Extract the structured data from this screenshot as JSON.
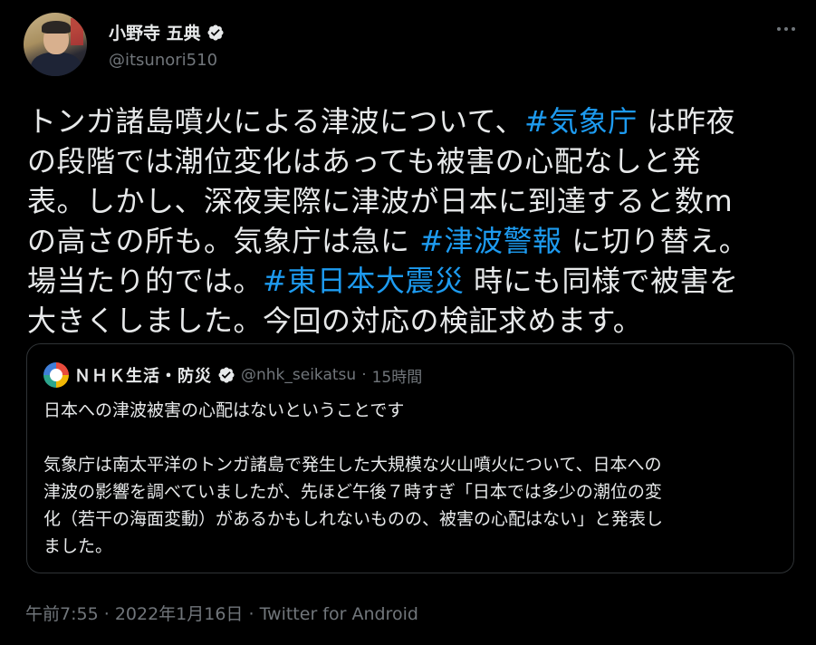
{
  "author": {
    "name": "小野寺 五典",
    "handle": "@itsunori510"
  },
  "tweet": {
    "lines": [
      {
        "before": "トンガ諸島噴火による津波について、",
        "tag": "#気象庁",
        "after": " は昨夜"
      },
      {
        "before": "の段階では潮位変化はあっても被害の心配なしと発",
        "tag": "",
        "after": ""
      },
      {
        "before": "表。しかし、深夜実際に津波が日本に到達すると数m",
        "tag": "",
        "after": ""
      },
      {
        "before": "の高さの所も。気象庁は急に ",
        "tag": "#津波警報",
        "after": " に切り替え。"
      },
      {
        "before": "場当たり的では。",
        "tag": "#東日本大震災",
        "after": " 時にも同様で被害を"
      },
      {
        "before": "大きくしました。今回の対応の検証求めます。",
        "tag": "",
        "after": ""
      }
    ]
  },
  "quote": {
    "name": "ＮＨＫ生活・防災",
    "handle": "@nhk_seikatsu",
    "separator": "·",
    "time": "15時間",
    "lines": [
      "日本への津波被害の心配はないということです",
      "",
      "気象庁は南太平洋のトンガ諸島で発生した大規模な火山噴火について、日本への",
      "津波の影響を調べていましたが、先ほど午後７時すぎ「日本では多少の潮位の変",
      "化（若干の海面変動）があるかもしれないものの、被害の心配はない」と発表し",
      "ました。"
    ]
  },
  "footer": {
    "time": "午前7:55",
    "sep1": "·",
    "date": "2022年1月16日",
    "sep2": "·",
    "source": "Twitter for Android"
  },
  "colors": {
    "background": "#000000",
    "text": "#e7e9ea",
    "secondary": "#71767b",
    "hashtag": "#1d9bf0",
    "border": "#2f3336"
  },
  "icons": {
    "verified": "verified-badge-icon",
    "more": "more-options-icon"
  }
}
